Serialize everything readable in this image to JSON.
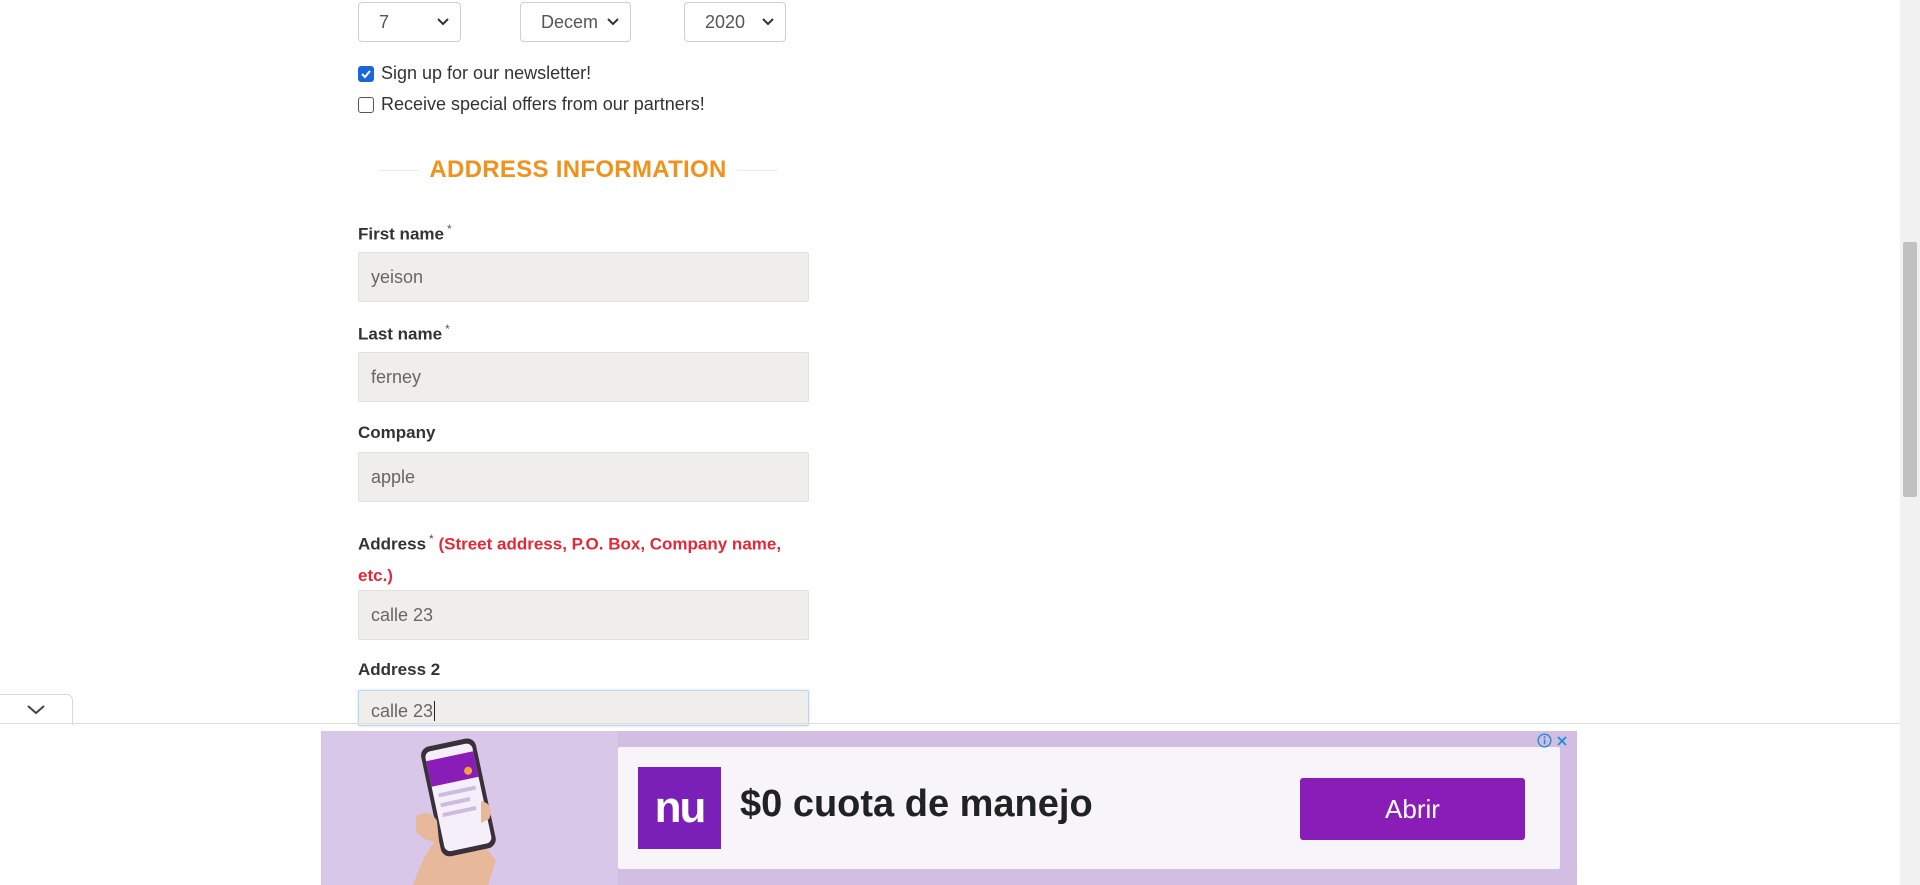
{
  "birth_date": {
    "day": "7",
    "month": "Decem",
    "year": "2020"
  },
  "options": {
    "newsletter_label": "Sign up for our newsletter!",
    "newsletter_checked": true,
    "offers_label": "Receive special offers from our partners!",
    "offers_checked": false
  },
  "address_section": {
    "title": "ADDRESS INFORMATION",
    "required_mark": "*",
    "first_name_label": "First name",
    "first_name_value": "yeison",
    "last_name_label": "Last name",
    "last_name_value": "ferney",
    "company_label": "Company",
    "company_value": "apple",
    "address_label": "Address",
    "address_hint": "(Street address, P.O. Box, Company name, etc.)",
    "address_value": "calle 23",
    "address2_label": "Address 2",
    "address2_value": "calle 23"
  },
  "ad": {
    "logo_text": "nu",
    "headline": "$0 cuota de manejo",
    "cta_label": "Abrir",
    "brand_color": "#8a1db8",
    "icons": [
      "info-icon",
      "close-icon"
    ]
  },
  "icons": {
    "select_chevron": "chevron-down-icon",
    "collapse_tab": "chevron-down-icon"
  },
  "colors": {
    "section_title": "#f0921b",
    "hint": "#e5273a",
    "checkbox_on": "#1a66d9",
    "field_bg": "#efeeea"
  }
}
